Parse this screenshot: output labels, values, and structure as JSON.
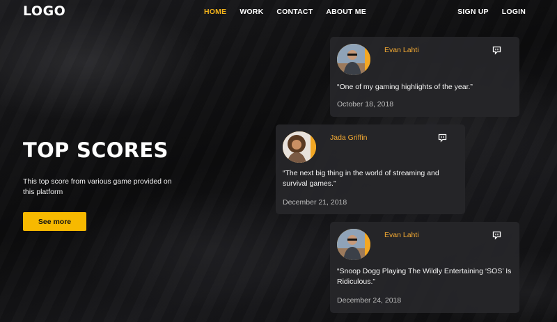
{
  "header": {
    "logo": "LOGO",
    "nav": [
      {
        "label": "HOME",
        "active": true
      },
      {
        "label": "WORK",
        "active": false
      },
      {
        "label": "CONTACT",
        "active": false
      },
      {
        "label": "ABOUT ME",
        "active": false
      }
    ],
    "auth": {
      "signup": "SIGN UP",
      "login": "LOGIN"
    }
  },
  "hero": {
    "title": "TOP SCORES",
    "description": "This top score from various game provided on this platform",
    "button": "See more"
  },
  "reviews": [
    {
      "name": "Evan Lahti",
      "quote": "“One of my gaming highlights of the year.”",
      "date": "October 18, 2018",
      "icon": "chat-icon"
    },
    {
      "name": "Jada Griffin",
      "quote": "“The next big thing in the world of streaming and survival games.”",
      "date": "December 21, 2018",
      "icon": "chat-icon"
    },
    {
      "name": "Evan Lahti",
      "quote": "“Snoop Dogg Playing The Wildly Entertaining ‘SOS’ Is Ridiculous.”",
      "date": "December 24, 2018",
      "icon": "chat-icon"
    }
  ],
  "colors": {
    "accent": "#f2b21b",
    "button": "#f7b900",
    "card": "#262629",
    "background": "#121214"
  }
}
